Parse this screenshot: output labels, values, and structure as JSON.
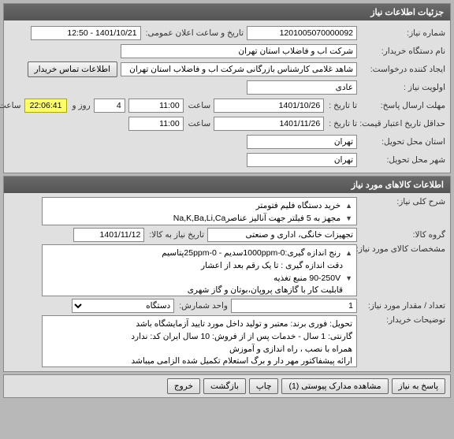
{
  "section1": {
    "title": "جزئیات اطلاعات نیاز",
    "need_no_label": "شماره نیاز:",
    "need_no": "1201005070000092",
    "announce_label": "تاریخ و ساعت اعلان عمومی:",
    "announce_value": "1401/10/21 - 12:50",
    "buyer_label": "نام دستگاه خریدار:",
    "buyer_value": "شرکت آب و فاضلاب استان تهران",
    "creator_label": "ایجاد کننده درخواست:",
    "creator_value": "شاهد غلامی کارشناس بازرگانی شرکت آب و فاضلاب استان تهران",
    "contact_btn": "اطلاعات تماس خریدار",
    "priority_label": "اولویت نیاز :",
    "priority_value": "عادی",
    "deadline_label": "مهلت ارسال پاسخ:",
    "to_date_label": "تا تاریخ :",
    "deadline_date": "1401/10/26",
    "time_label": "ساعت",
    "deadline_time": "11:00",
    "days_value": "4",
    "days_label": "روز و",
    "countdown": "22:06:41",
    "remain_label": "ساعت باقی مانده",
    "validity_label": "حداقل تاریخ اعتبار قیمت:",
    "validity_date": "1401/11/26",
    "validity_time": "11:00",
    "province_label": "استان محل تحویل:",
    "province_value": "تهران",
    "city_label": "شهر محل تحویل:",
    "city_value": "تهران"
  },
  "section2": {
    "title": "اطلاعات کالاهای مورد نیاز",
    "desc_label": "شرح کلی نیاز:",
    "desc_line1": "خرید دستگاه فلیم فتومتر",
    "desc_line2": "مجهز به 5 فیلتر جهت آنالیز عناصرNa,K,Ba,Li,Ca",
    "group_label": "گروه کالا:",
    "group_value": "تجهیزات خانگی، اداری و صنعتی",
    "need_date_label": "تاریخ نیاز به کالا:",
    "need_date_value": "1401/11/12",
    "spec_label": "مشخصات کالای مورد نیاز:",
    "spec_line1": "رنج اندازه گیری:1000ppm-0سدیم   -    25ppm-0پتاسیم",
    "spec_line2": "دقت اندازه گیری : تا یک رقم بعد از اعشار",
    "spec_line3": "90-250V  منبع تغذیه",
    "spec_line4": "قابلیت کار با گازهای پروپان،بوتان و گاز شهری",
    "qty_label": "تعداد / مقدار مورد نیاز:",
    "qty_value": "1",
    "unit_label": "واحد شمارش:",
    "unit_value": "دستگاه",
    "notes_label": "توضیحات خریدار:",
    "notes_line1": "تحویل:  فوری   برند:  معتبر و تولید داخل مورد  تایید آزمایشگاه باشد",
    "notes_line2": "گارنتی: 1 سال - خدمات پس از از فروش: 10 سال  ایران کد: ندارد",
    "notes_line3": "همراه با نصب ، راه اندازی و آموزش",
    "notes_line4": "ارائه پیشفاکتور مهر دار و برگ استعلام تکمیل شده الزامی میباشد"
  },
  "footer": {
    "reply": "پاسخ به نیاز",
    "view_docs": "مشاهده مدارک پیوستی (1)",
    "print": "چاپ",
    "back": "بازگشت",
    "exit": "خروج"
  }
}
